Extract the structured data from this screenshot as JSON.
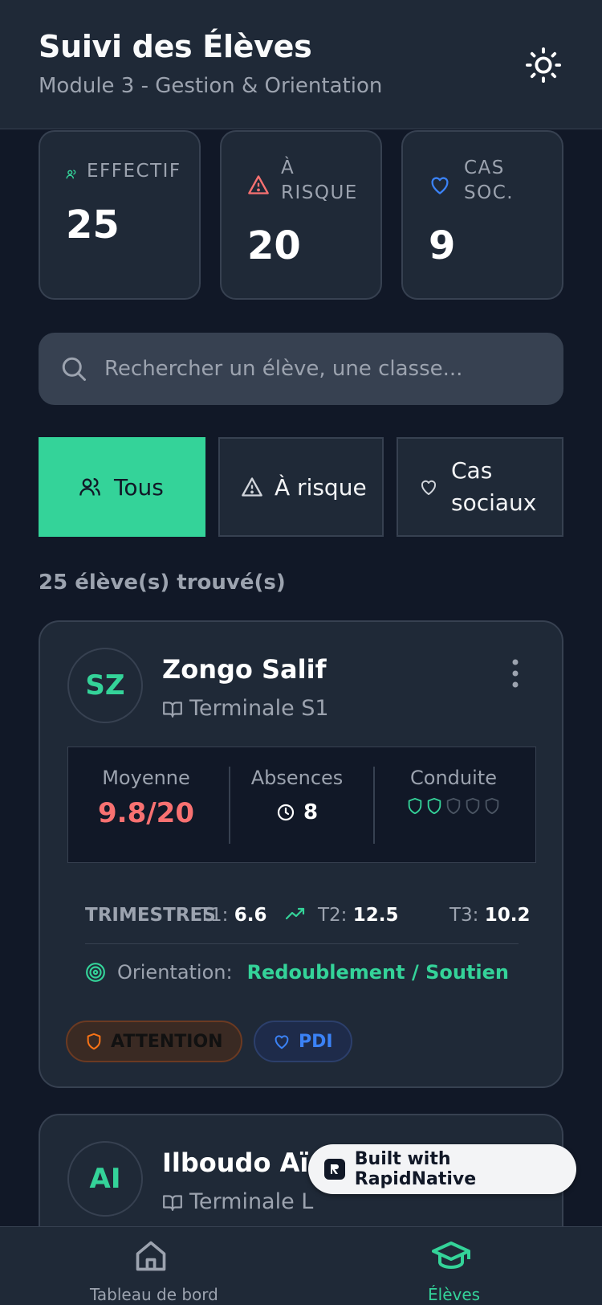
{
  "header": {
    "title": "Suivi des Élèves",
    "subtitle": "Module 3 - Gestion & Orientation",
    "theme_icon": "sun-icon"
  },
  "stats": [
    {
      "label": "EFFECTIF",
      "value": "25",
      "icon": "users-icon",
      "color": "#34d399"
    },
    {
      "label_line1": "À",
      "label_line2": "RISQUE",
      "value": "20",
      "icon": "alert-triangle-icon",
      "color": "#f87171"
    },
    {
      "label_line1": "CAS",
      "label_line2": "SOC.",
      "value": "9",
      "icon": "heart-icon",
      "color": "#3b82f6"
    }
  ],
  "search": {
    "placeholder": "Rechercher un élève, une classe..."
  },
  "filters": [
    {
      "label": "Tous",
      "active": true
    },
    {
      "label": "À risque",
      "active": false
    },
    {
      "label_line1": "Cas",
      "label_line2": "sociaux",
      "active": false
    }
  ],
  "results_count": "25 élève(s) trouvé(s)",
  "students": [
    {
      "initials": "SZ",
      "name": "Zongo Salif",
      "class": "Terminale S1",
      "moyenne_label": "Moyenne",
      "moyenne": "9.8/20",
      "absences_label": "Absences",
      "absences": "8",
      "conduite_label": "Conduite",
      "conduite_rating": 2,
      "conduite_max": 5,
      "trimestres_label": "TRIMESTRES",
      "t1_label": "T1:",
      "t1": "6.6",
      "t2_label": "T2:",
      "t2": "12.5",
      "t3_label": "T3:",
      "t3": "10.2",
      "orientation_label": "Orientation:",
      "orientation": "Redoublement / Soutien",
      "badges": [
        {
          "label": "ATTENTION",
          "icon": "shield-icon"
        },
        {
          "label": "PDI",
          "icon": "heart-icon"
        }
      ]
    },
    {
      "initials": "AI",
      "name": "Ilboudo Aïcha",
      "class": "Terminale L"
    }
  ],
  "brand": "Built with RapidNative",
  "nav": [
    {
      "label": "Tableau de bord",
      "icon": "home-icon",
      "active": false
    },
    {
      "label": "Élèves",
      "icon": "graduation-cap-icon",
      "active": true
    }
  ],
  "colors": {
    "accent": "#34d399",
    "danger": "#f87171",
    "info": "#3b82f6",
    "bg": "#111827",
    "card": "#1f2937"
  }
}
